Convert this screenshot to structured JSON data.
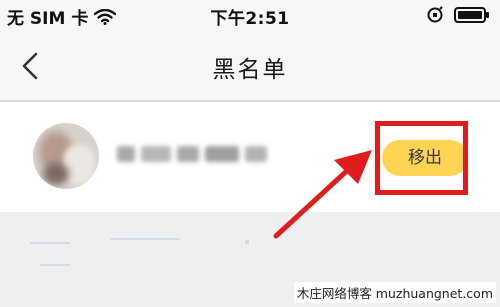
{
  "status_bar": {
    "carrier": "无 SIM 卡",
    "time": "下午2:51"
  },
  "nav": {
    "title": "黑名单",
    "back_icon": "chevron-left-icon"
  },
  "blacklist": {
    "items": [
      {
        "remove_label": "移出"
      }
    ]
  },
  "annotation": {
    "highlight_color": "#e01c1c"
  },
  "colors": {
    "button": "#ffd452",
    "background": "#efefef",
    "bar": "#f7f7f7"
  },
  "watermark": {
    "text": "木庄网络博客 muzhuangnet.com"
  }
}
